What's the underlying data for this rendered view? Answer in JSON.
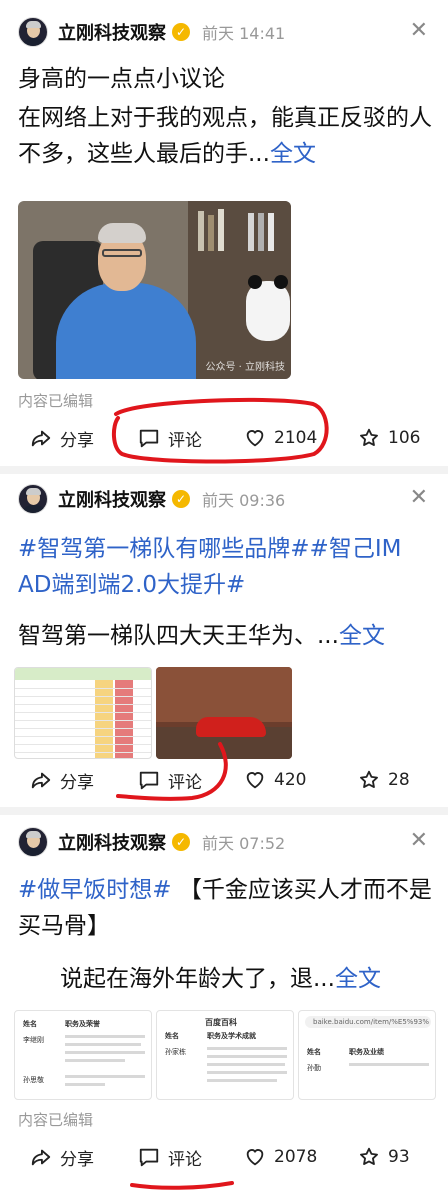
{
  "account": {
    "name": "立刚科技观察",
    "verified_badge": "✓"
  },
  "posts": [
    {
      "time": "前天 14:41",
      "title": "身高的一点点小议论",
      "body": "在网络上对于我的观点，能真正反驳的人不多，这些人最后的手...",
      "more": "全文",
      "edited": "内容已编辑",
      "image_watermark": "公众号 · 立刚科技",
      "actions": {
        "share": "分享",
        "comment": "评论",
        "likes": "2104",
        "favorites": "106"
      }
    },
    {
      "time": "前天 09:36",
      "hashtags": "#智驾第一梯队有哪些品牌##智己IM AD端到端2.0大提升#",
      "body": "智驾第一梯队四大天王华为、...",
      "more": "全文",
      "actions": {
        "share": "分享",
        "comment": "评论",
        "likes": "420",
        "favorites": "28"
      }
    },
    {
      "time": "前天 07:52",
      "hashtag": "#做早饭时想#",
      "title_tail": "【千金应该买人才而不是买马骨】",
      "body": "说起在海外年龄大了，退...",
      "more": "全文",
      "edited": "内容已编辑",
      "docs": [
        {
          "col1": "姓名",
          "col2": "职务及荣誉",
          "name": "李继刚",
          "name2": "孙思敬"
        },
        {
          "title": "百度百科",
          "col1": "姓名",
          "col2": "职务及学术成就",
          "name": "孙家栋"
        },
        {
          "url": "baike.baidu.com/item/%E5%93%",
          "col1": "姓名",
          "col2": "职务及业绩",
          "name": "孙勤"
        }
      ],
      "actions": {
        "share": "分享",
        "comment": "评论",
        "likes": "2078",
        "favorites": "93"
      }
    }
  ],
  "colors": {
    "link": "#2f63c8",
    "annotation": "#e0161c",
    "badge": "#f5b800"
  }
}
